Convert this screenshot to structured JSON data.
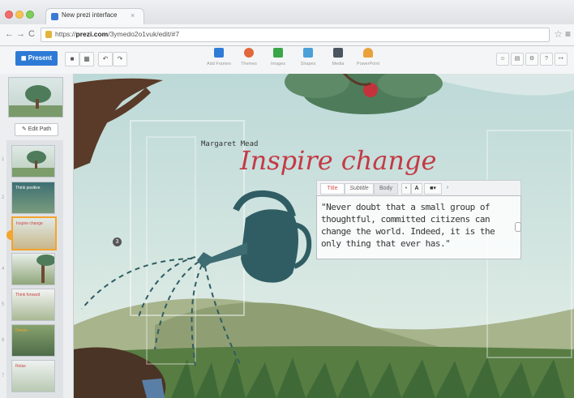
{
  "browser": {
    "tab_title": "New prezi interface",
    "tab_close": "×",
    "url_scheme": "https://",
    "url_host": "prezi.com",
    "url_path": "/3ymedo2o1vuk/edit/#7",
    "nav_back": "←",
    "nav_forward": "→",
    "reload": "C",
    "star": "☆",
    "menu": "≡"
  },
  "toolbar": {
    "present_label": "Present",
    "insert_items": [
      {
        "label": "Add Frames",
        "icon": "plus-icon",
        "color": "#2f7bd8"
      },
      {
        "label": "Themes",
        "icon": "palette-icon",
        "color": "#e2673a"
      },
      {
        "label": "Images",
        "icon": "image-icon",
        "color": "#3aa648"
      },
      {
        "label": "Shapes",
        "icon": "shapes-icon",
        "color": "#4aa0d8"
      },
      {
        "label": "Media",
        "icon": "media-icon",
        "color": "#4a5560"
      },
      {
        "label": "PowerPoint",
        "icon": "powerpoint-icon",
        "color": "#e9a23b"
      }
    ],
    "accent": "#2d7ad6"
  },
  "sidebar": {
    "edit_path_label": "Edit Path",
    "thumb_captions": [
      "",
      "Think positive",
      "Inspire change",
      "",
      "Think forward",
      "Dream",
      "Relax"
    ],
    "step_numbers": [
      "1",
      "2",
      "3",
      "4",
      "5",
      "6",
      "7"
    ]
  },
  "canvas": {
    "title": "Inspire change",
    "quote": "\"Never doubt that a small group of thoughtful, committed citizens can change the world. Indeed, it is the only thing that ever has.\"",
    "author": "Margaret Mead",
    "path_step": "3",
    "title_color": "#c43a45",
    "format_bar": {
      "title": "Title",
      "subtitle": "Subtitle",
      "body": "Body",
      "bullet": "•",
      "font": "A",
      "color": "■▾",
      "more": "›"
    }
  }
}
